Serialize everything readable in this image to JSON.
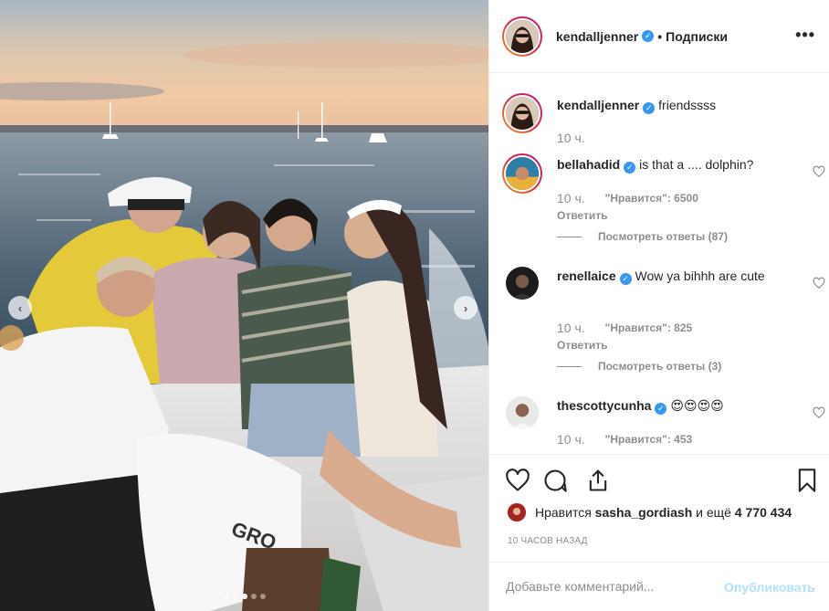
{
  "post": {
    "author": "kendalljenner",
    "separator": "•",
    "follow_label": "Подписки",
    "more_label": "•••",
    "caption": {
      "username": "kendalljenner",
      "text": "friendssss",
      "time": "10 ч."
    },
    "comments": [
      {
        "username": "bellahadid",
        "text": "is that a .... dolphin?",
        "time": "10 ч.",
        "likes": "\"Нравится\": 6500",
        "reply": "Ответить",
        "view_replies": "Посмотреть ответы (87)"
      },
      {
        "username": "renellaice",
        "text": "Wow ya bihhh are cute",
        "time": "10 ч.",
        "likes": "\"Нравится\": 825",
        "reply": "Ответить",
        "view_replies": "Посмотреть ответы (3)"
      },
      {
        "username": "thescottycunha",
        "text": "😍😍😍😍",
        "time": "10 ч.",
        "likes": "\"Нравится\": 453"
      }
    ],
    "liked_by": {
      "prefix": "Нравится",
      "user": "sasha_gordiash",
      "middle": "и ещё",
      "count": "4 770 434"
    },
    "time_ago": "10 ЧАСОВ НАЗАД",
    "comment_input": {
      "placeholder": "Добавьте комментарий..."
    },
    "publish_label": "Опубликовать",
    "carousel": {
      "prev_icon": "chevron-left-icon",
      "next_icon": "chevron-right-icon",
      "slides": 5,
      "active_slide": 3
    },
    "colors": {
      "verified": "#3897f0",
      "publish_disabled": "#b2dffc",
      "muted": "#8e8e8e"
    }
  }
}
